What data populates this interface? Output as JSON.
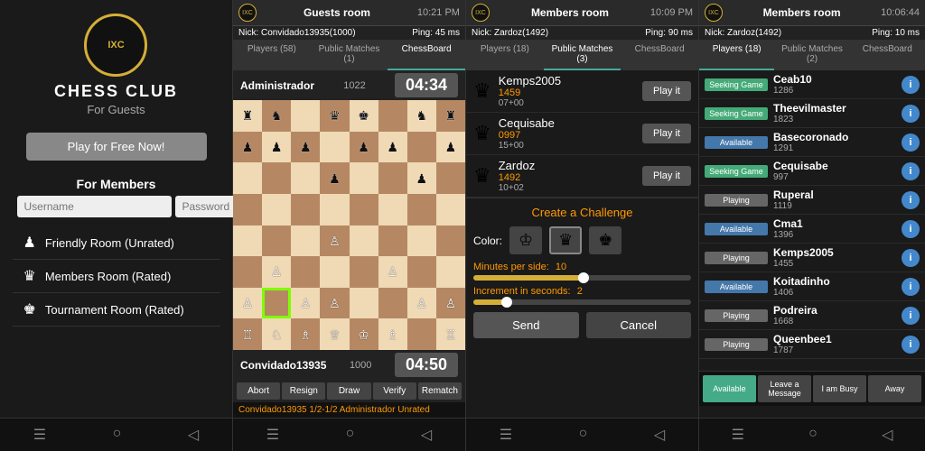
{
  "panel1": {
    "logo_text": "IXC",
    "title": "CHESS CLUB",
    "for_guests": "For Guests",
    "play_btn": "Play for Free Now!",
    "for_members": "For Members",
    "username_placeholder": "Username",
    "password_placeholder": "Password",
    "rooms": [
      {
        "icon": "♟",
        "label": "Friendly Room (Unrated)"
      },
      {
        "icon": "♛",
        "label": "Members Room (Rated)"
      },
      {
        "icon": "♚",
        "label": "Tournament Room (Rated)"
      }
    ],
    "nav_icons": [
      "☰",
      "○",
      "◁"
    ]
  },
  "panel2": {
    "room_name": "Guests room",
    "time": "10:21 PM",
    "nick": "Nick: Convidado13935(1000)",
    "ping": "Ping: 45 ms",
    "tabs": [
      "Players (58)",
      "Public Matches (1)",
      "ChessBoard"
    ],
    "top_player": {
      "name": "Administrador",
      "rating": "1022"
    },
    "bottom_player": {
      "name": "Convidado13935",
      "rating": "1000"
    },
    "top_timer": "04:34",
    "bottom_timer": "04:50",
    "actions": [
      "Abort",
      "Resign",
      "Draw",
      "Verify",
      "Rematch"
    ],
    "status": "Convidado13935 1/2-1/2 Administrador Unrated"
  },
  "panel3": {
    "room_name": "Members room",
    "time": "10:09 PM",
    "nick": "Nick: Zardoz(1492)",
    "ping": "Ping: 90 ms",
    "tabs": [
      "Players (18)",
      "Public Matches (3)",
      "ChessBoard"
    ],
    "matches": [
      {
        "name": "Kemps2005",
        "rating": "1459",
        "time": "07+00"
      },
      {
        "name": "Cequisabe",
        "rating": "0997",
        "time": "15+00"
      },
      {
        "name": "Zardoz",
        "rating": "1492",
        "time": "10+02"
      }
    ],
    "challenge_title": "Create a Challenge",
    "color_label": "Color:",
    "minutes_label": "Minutes per side:",
    "minutes_value": "10",
    "increment_label": "Increment in seconds:",
    "increment_value": "2",
    "send_btn": "Send",
    "cancel_btn": "Cancel",
    "nav_icons": [
      "☰",
      "○",
      "◁"
    ]
  },
  "panel4": {
    "room_name": "Members room",
    "time": "10:06:44",
    "nick": "Nick: Zardoz(1492)",
    "ping": "Ping: 10 ms",
    "tabs": [
      "Players (18)",
      "Public Matches (2)",
      "ChessBoard"
    ],
    "players": [
      {
        "status": "Seeking Game",
        "status_type": "seeking",
        "name": "Ceab10",
        "rating": "1286"
      },
      {
        "status": "Seeking Game",
        "status_type": "seeking",
        "name": "Theevilmaster",
        "rating": "1823"
      },
      {
        "status": "Available",
        "status_type": "available",
        "name": "Basecoronado",
        "rating": "1291"
      },
      {
        "status": "Seeking Game",
        "status_type": "seeking",
        "name": "Cequisabe",
        "rating": "997"
      },
      {
        "status": "Playing",
        "status_type": "playing",
        "name": "Ruperal",
        "rating": "1119"
      },
      {
        "status": "Available",
        "status_type": "available",
        "name": "Cma1",
        "rating": "1396"
      },
      {
        "status": "Playing",
        "status_type": "playing",
        "name": "Kemps2005",
        "rating": "1455"
      },
      {
        "status": "Available",
        "status_type": "available",
        "name": "Koitadinho",
        "rating": "1406"
      },
      {
        "status": "Playing",
        "status_type": "playing",
        "name": "Podreira",
        "rating": "1668"
      },
      {
        "status": "Playing",
        "status_type": "playing",
        "name": "Queenbee1",
        "rating": "1787"
      }
    ],
    "bottom_actions": [
      "Available",
      "Leave a Message",
      "I am Busy",
      "Away"
    ],
    "nav_icons": [
      "☰",
      "○",
      "◁"
    ]
  },
  "board": {
    "pieces": [
      [
        "♜",
        "♞",
        "",
        "♛",
        "♚",
        "",
        "♞",
        "♜"
      ],
      [
        "♟",
        "♟",
        "♟",
        "",
        "♟",
        "♟",
        "",
        "♟"
      ],
      [
        "",
        "",
        "",
        "♟",
        "",
        "",
        "♟",
        ""
      ],
      [
        "",
        "",
        "",
        "",
        "",
        "",
        "",
        ""
      ],
      [
        "",
        "",
        "",
        "♙",
        "",
        "",
        "",
        ""
      ],
      [
        "",
        "♙",
        "",
        "",
        "",
        "♙",
        "",
        ""
      ],
      [
        "♙",
        "",
        "♙",
        "♙",
        "",
        "",
        "♙",
        "♙"
      ],
      [
        "♖",
        "♘",
        "♗",
        "♕",
        "♔",
        "♗",
        "",
        "♖"
      ]
    ]
  }
}
